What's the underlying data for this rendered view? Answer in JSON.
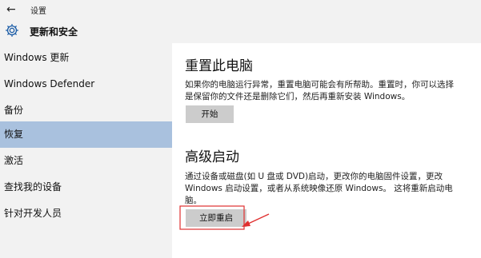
{
  "window": {
    "title": "设置"
  },
  "header": {
    "title": "更新和安全",
    "icon": "gear-icon"
  },
  "sidebar": {
    "items": [
      {
        "label": "Windows 更新"
      },
      {
        "label": "Windows Defender"
      },
      {
        "label": "备份"
      },
      {
        "label": "恢复",
        "active": true
      },
      {
        "label": "激活"
      },
      {
        "label": "查找我的设备"
      },
      {
        "label": "针对开发人员"
      }
    ]
  },
  "sections": {
    "reset": {
      "title": "重置此电脑",
      "description": "如果你的电脑运行异常，重置电脑可能会有所帮助。重置时，你可以选择是保留你的文件还是删除它们，然后再重新安装 Windows。",
      "button": "开始"
    },
    "advanced": {
      "title": "高级启动",
      "description": "通过设备或磁盘(如 U 盘或 DVD)启动，更改你的电脑固件设置，更改 Windows 启动设置，或者从系统映像还原 Windows。 这将重新启动电脑。",
      "button": "立即重启"
    }
  },
  "colors": {
    "sidebar_bg": "#f2f2f2",
    "active_bg": "#a9c1de",
    "content_bg": "#ffffff",
    "button_bg": "#cccccc",
    "annotation": "#e03030"
  }
}
